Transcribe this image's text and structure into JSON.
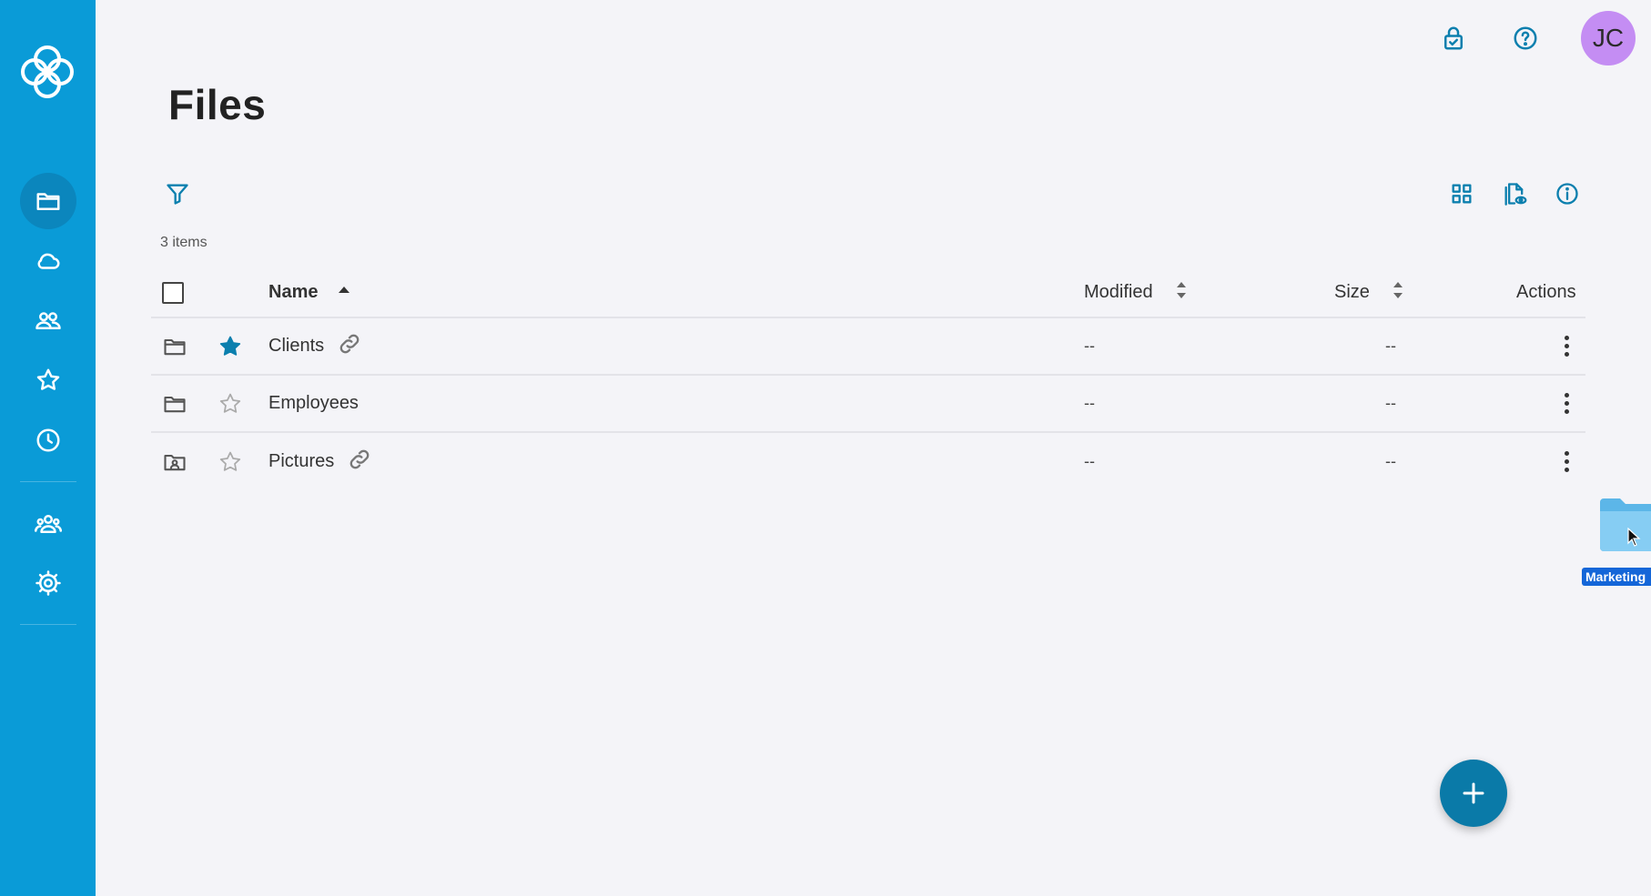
{
  "app": {
    "title": "Files"
  },
  "header": {
    "icons": [
      "lock-check-icon",
      "help-icon"
    ],
    "avatar_initials": "JC",
    "avatar_color": "#c48df3"
  },
  "sidebar": {
    "color": "#0a9bd7",
    "items": [
      {
        "icon": "folder-icon",
        "active": true
      },
      {
        "icon": "cloud-icon",
        "active": false
      },
      {
        "icon": "shared-users-icon",
        "active": false
      },
      {
        "icon": "star-icon",
        "active": false
      },
      {
        "icon": "clock-icon",
        "active": false
      },
      {
        "icon": "users-group-icon",
        "active": false
      },
      {
        "icon": "gear-icon",
        "active": false
      }
    ]
  },
  "toolbar": {
    "filter_icon": "filter-icon",
    "view_icons": [
      "grid-view-icon",
      "preview-icon",
      "info-icon"
    ]
  },
  "list": {
    "count_text": "3 items",
    "columns": {
      "name": "Name",
      "modified": "Modified",
      "size": "Size",
      "actions": "Actions"
    },
    "rows": [
      {
        "name": "Clients",
        "type": "folder",
        "starred": true,
        "shared_link": true,
        "modified": "--",
        "size": "--"
      },
      {
        "name": "Employees",
        "type": "folder",
        "starred": false,
        "shared_link": false,
        "modified": "--",
        "size": "--"
      },
      {
        "name": "Pictures",
        "type": "folder-contacts",
        "starred": false,
        "shared_link": true,
        "modified": "--",
        "size": "--"
      }
    ]
  },
  "drag": {
    "label": "Marketing"
  },
  "fab": {
    "icon": "plus-icon"
  },
  "colors": {
    "accent": "#0b7fae",
    "background": "#f4f4f8"
  }
}
